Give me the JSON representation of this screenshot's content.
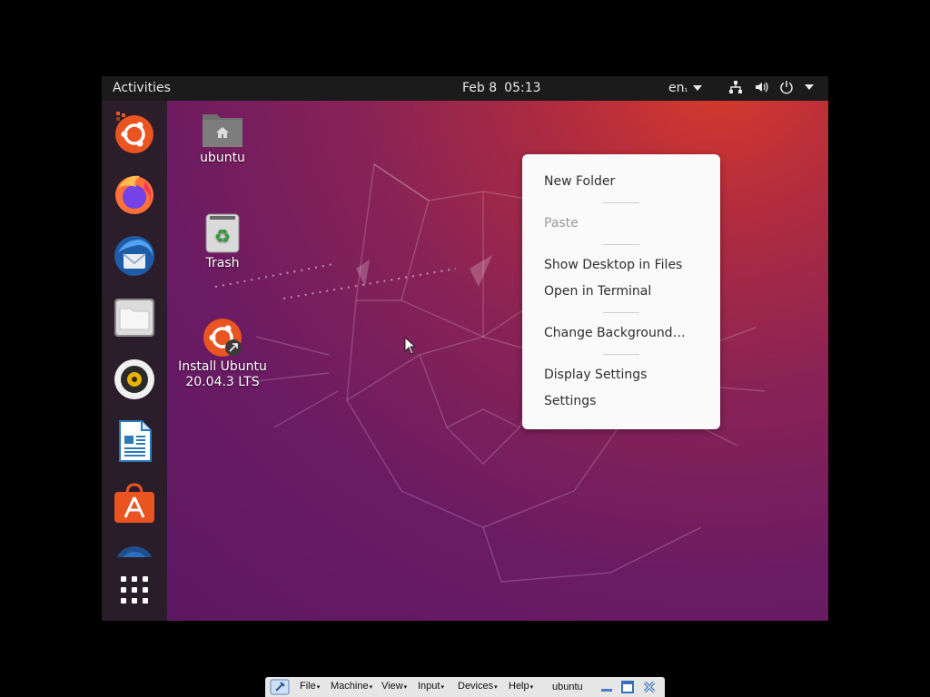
{
  "topbar": {
    "activities": "Activities",
    "date": "Feb 8",
    "time": "05:13",
    "language": "en",
    "language_suffix": "₁"
  },
  "dock": {
    "items": [
      {
        "name": "Install Ubuntu",
        "icon": "ubuntu-installer-icon"
      },
      {
        "name": "Firefox",
        "icon": "firefox-icon"
      },
      {
        "name": "Thunderbird",
        "icon": "thunderbird-icon"
      },
      {
        "name": "Files",
        "icon": "files-icon"
      },
      {
        "name": "Rhythmbox",
        "icon": "rhythmbox-icon"
      },
      {
        "name": "LibreOffice Writer",
        "icon": "writer-icon"
      },
      {
        "name": "Ubuntu Software",
        "icon": "software-icon"
      },
      {
        "name": "Help",
        "icon": "help-icon"
      },
      {
        "name": "Show Applications",
        "icon": "app-grid-icon"
      }
    ]
  },
  "desktop": {
    "icons": [
      {
        "label": "ubuntu",
        "icon": "home-folder-icon"
      },
      {
        "label": "Trash",
        "icon": "trash-icon"
      },
      {
        "label_line1": "Install Ubuntu",
        "label_line2": "20.04.3 LTS",
        "icon": "ubuntu-installer-icon"
      }
    ]
  },
  "context_menu": {
    "items": [
      {
        "label": "New Folder",
        "enabled": true
      },
      {
        "label": "Paste",
        "enabled": false
      },
      {
        "label": "Show Desktop in Files",
        "enabled": true
      },
      {
        "label": "Open in Terminal",
        "enabled": true
      },
      {
        "label": "Change Background…",
        "enabled": true
      },
      {
        "label": "Display Settings",
        "enabled": true
      },
      {
        "label": "Settings",
        "enabled": true
      }
    ]
  },
  "vbox_bar": {
    "menus": [
      "File",
      "Machine",
      "View",
      "Input",
      "Devices",
      "Help"
    ],
    "vm_name": "ubuntu"
  },
  "colors": {
    "topbar_bg": "#1b1b1b",
    "menu_bg": "#fafafa",
    "ubuntu_orange": "#e95420"
  }
}
